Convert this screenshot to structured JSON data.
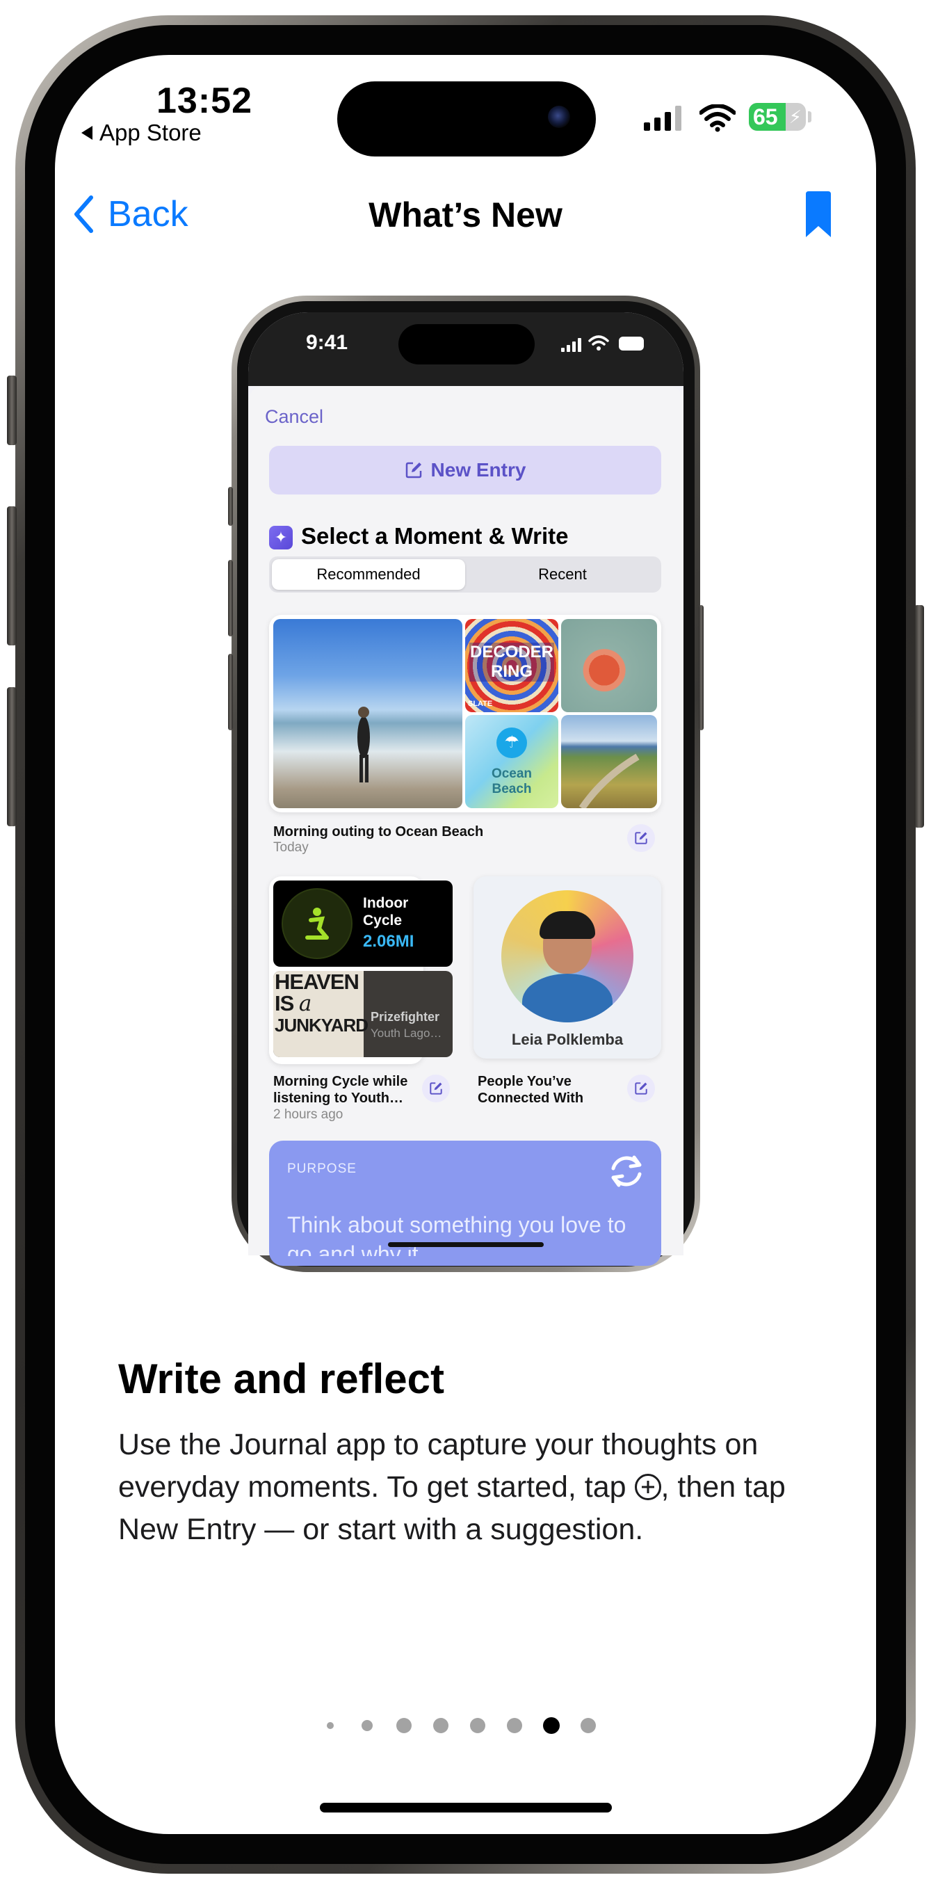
{
  "status_bar": {
    "time": "13:52",
    "back_app_label": "App Store",
    "battery_percent": "65",
    "battery_level": 0.65
  },
  "nav": {
    "back_label": "Back",
    "title": "What’s New"
  },
  "preview": {
    "time": "9:41",
    "cancel_label": "Cancel",
    "new_entry_label": "New Entry",
    "section_title": "Select a Moment & Write",
    "segments": [
      "Recommended",
      "Recent"
    ],
    "selected_segment": "Recommended",
    "card1": {
      "title": "Morning outing to Ocean Beach",
      "subtitle": "Today",
      "podcast_line1": "DECODER",
      "podcast_line2": "RING",
      "podcast_brand": "SLATE",
      "location_line1": "Ocean",
      "location_line2": "Beach"
    },
    "card2": {
      "workout_line1": "Indoor",
      "workout_line2": "Cycle",
      "workout_distance": "2.06MI",
      "album_line1": "HEAVEN",
      "album_line2": "IS",
      "album_line3": "a",
      "album_line4": "JUNKYARD",
      "artist": "Prizefighter",
      "album_subtitle": "Youth Lago…",
      "title_line1": "Morning Cycle while",
      "title_line2": "listening to Youth…",
      "subtitle": "2 hours ago"
    },
    "card3": {
      "person_name": "Leia Polklemba",
      "title_line1": "People You’ve",
      "title_line2": "Connected With"
    },
    "purpose": {
      "label": "PURPOSE",
      "text": "Think about something you love to go and why it"
    }
  },
  "content": {
    "heading": "Write and reflect",
    "body_part1": "Use the Journal app to capture your thoughts on everyday moments. To get started, tap ",
    "body_part2": ", then tap New Entry — or start with a suggestion."
  },
  "pagination": {
    "count": 8,
    "current_index": 6
  },
  "colors": {
    "accent": "#0a7aff",
    "journal_purple": "#5b52c7",
    "battery_green": "#34c759",
    "purpose_blue": "#8a99f0"
  }
}
